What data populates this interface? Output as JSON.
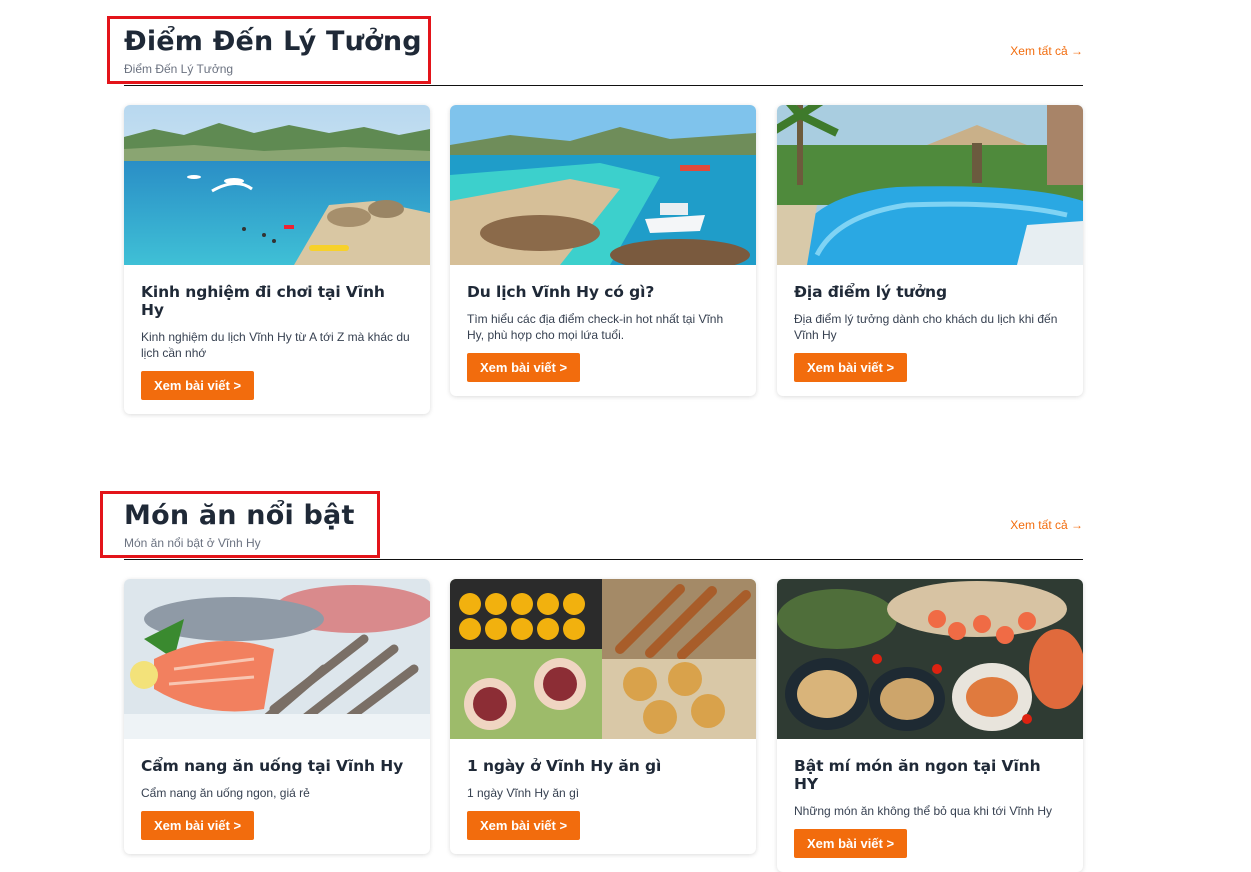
{
  "sections": [
    {
      "title": "Điểm Đến Lý Tưởng",
      "subtitle": "Điểm Đến Lý Tưởng",
      "see_all": "Xem tất cả →",
      "cards": [
        {
          "title": "Kinh nghiệm đi chơi tại Vĩnh Hy",
          "desc": "Kinh nghiệm du lịch Vĩnh Hy từ A tới Z mà khác du lịch cần nhớ",
          "button": "Xem bài viết >",
          "image": "beach-bay-with-jetskis-photo"
        },
        {
          "title": "Du lịch Vĩnh Hy có gì?",
          "desc": "Tìm hiểu các địa điểm check-in hot nhất tại Vĩnh Hy, phù hợp cho mọi lứa tuổi.",
          "button": "Xem bài viết >",
          "image": "turquoise-beach-with-boat-photo"
        },
        {
          "title": "Địa điểm lý tưởng",
          "desc": "Địa điểm lý tưởng dành cho khách du lịch khi đến Vĩnh Hy",
          "button": "Xem bài viết >",
          "image": "resort-pool-with-palms-photo"
        }
      ]
    },
    {
      "title": "Món ăn nổi bật",
      "subtitle": "Món ăn nổi bật ở Vĩnh Hy",
      "see_all": "Xem tất cả →",
      "cards": [
        {
          "title": "Cẩm nang ăn uống tại Vĩnh Hy",
          "desc": "Cẩm nang ăn uống ngon, giá rẻ",
          "button": "Xem bài viết >",
          "image": "fresh-fish-and-shrimp-photo"
        },
        {
          "title": "1 ngày ở Vĩnh Hy ăn gì",
          "desc": "1 ngày Vĩnh Hy ăn gì",
          "button": "Xem bài viết >",
          "image": "local-dishes-collage-photo"
        },
        {
          "title": "Bật mí món ăn ngon tại Vĩnh HY",
          "desc": "Những món ăn không thể bỏ qua khi tới Vĩnh Hy",
          "button": "Xem bài viết >",
          "image": "seafood-platter-photo"
        }
      ]
    }
  ],
  "colors": {
    "accent": "#f26c0d",
    "highlight_border": "#e3141a",
    "title": "#1f2937"
  }
}
